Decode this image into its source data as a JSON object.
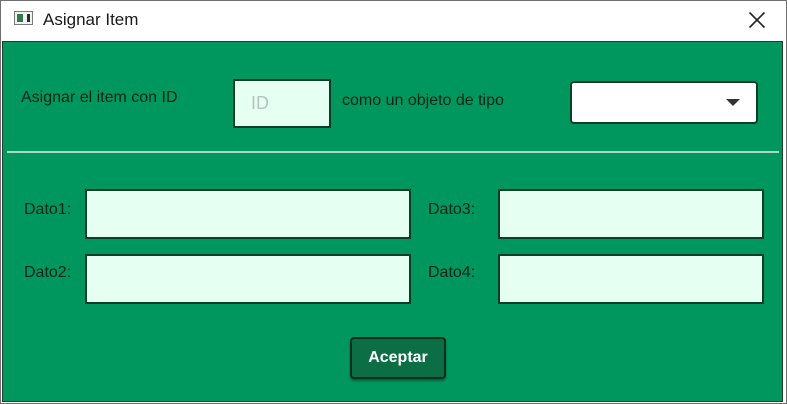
{
  "window": {
    "title": "Asignar Item",
    "app_icon": "window-app-icon",
    "close_icon": "close-icon"
  },
  "form": {
    "assign_label": "Asignar el item con ID",
    "id_placeholder": "ID",
    "id_value": "",
    "type_label": "como un objeto de tipo",
    "type_selected": ""
  },
  "fields": {
    "dato1_label": "Dato1:",
    "dato2_label": "Dato2:",
    "dato3_label": "Dato3:",
    "dato4_label": "Dato4:",
    "dato1_value": "",
    "dato2_value": "",
    "dato3_value": "",
    "dato4_value": ""
  },
  "actions": {
    "accept_label": "Aceptar"
  },
  "colors": {
    "panel_background": "#00975e",
    "input_background": "#e6fff3",
    "border": "#0f3d26",
    "button_background": "#0b6e45"
  }
}
